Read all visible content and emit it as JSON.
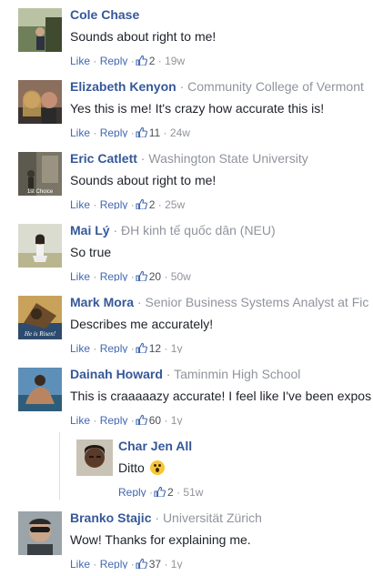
{
  "actions": {
    "like": "Like",
    "reply": "Reply",
    "dot": "·"
  },
  "comments": [
    {
      "author": "Cole Chase",
      "affiliation": "",
      "text": "Sounds about right to me!",
      "likes": "2",
      "time": "19w"
    },
    {
      "author": "Elizabeth Kenyon",
      "affiliation": "Community College of Vermont",
      "text": "Yes this is me! It's crazy how accurate this is!",
      "likes": "11",
      "time": "24w"
    },
    {
      "author": "Eric Catlett",
      "affiliation": "Washington State University",
      "text": "Sounds about right to me!",
      "likes": "2",
      "time": "25w"
    },
    {
      "author": "Mai Lý",
      "affiliation": "ĐH kinh tế quốc dân (NEU)",
      "text": "So true",
      "likes": "20",
      "time": "50w"
    },
    {
      "author": "Mark Mora",
      "affiliation": "Senior Business Systems Analyst at Fic",
      "text": "Describes me accurately!",
      "likes": "12",
      "time": "1y"
    },
    {
      "author": "Dainah Howard",
      "affiliation": "Taminmin High School",
      "text": "This is craaaaazy accurate! I feel like I've been expos",
      "likes": "60",
      "time": "1y"
    },
    {
      "author": "Branko Stajic",
      "affiliation": "Universität Zürich",
      "text": "Wow! Thanks for explaining me.",
      "likes": "37",
      "time": "1y"
    }
  ],
  "reply": {
    "author": "Char Jen All",
    "text": "Ditto",
    "likes": "2",
    "time": "51w"
  },
  "avatar_image_text": {
    "eric": "1st Choice",
    "mark": "He is Risen!"
  },
  "colors": {
    "name": "#365899",
    "link": "#4267b2",
    "meta": "#90949c",
    "text": "#1d2129"
  }
}
